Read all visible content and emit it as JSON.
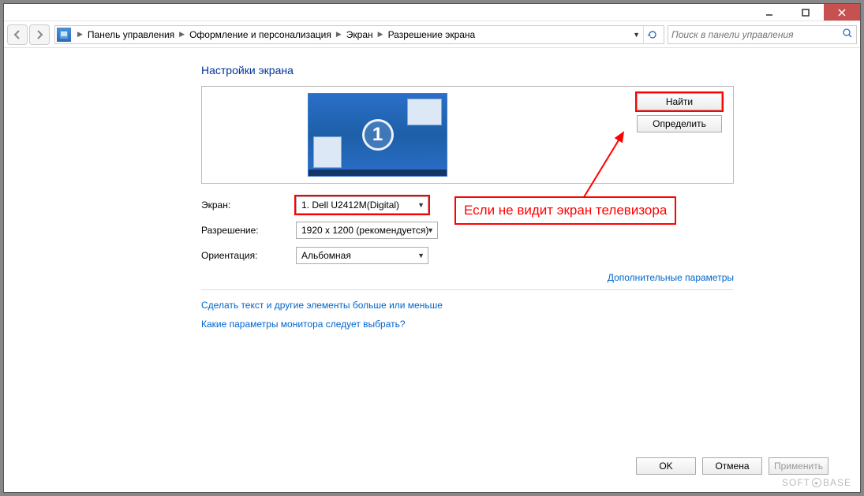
{
  "breadcrumb": {
    "items": [
      "Панель управления",
      "Оформление и персонализация",
      "Экран",
      "Разрешение экрана"
    ]
  },
  "search": {
    "placeholder": "Поиск в панели управления"
  },
  "page": {
    "title": "Настройки экрана",
    "buttons": {
      "detect": "Найти",
      "identify": "Определить"
    },
    "monitor_number": "1",
    "labels": {
      "display": "Экран:",
      "resolution": "Разрешение:",
      "orientation": "Ориентация:"
    },
    "values": {
      "display": "1. Dell U2412M(Digital)",
      "resolution": "1920 x 1200 (рекомендуется)",
      "orientation": "Альбомная"
    },
    "advanced_link": "Дополнительные параметры",
    "help_links": {
      "text_size": "Сделать текст и другие элементы больше или меньше",
      "which_settings": "Какие параметры монитора следует выбрать?"
    },
    "footer": {
      "ok": "OK",
      "cancel": "Отмена",
      "apply": "Применить"
    }
  },
  "annotation": {
    "text": "Если не видит экран телевизора"
  },
  "watermark": {
    "left": "SOFT",
    "right": "BASE"
  }
}
